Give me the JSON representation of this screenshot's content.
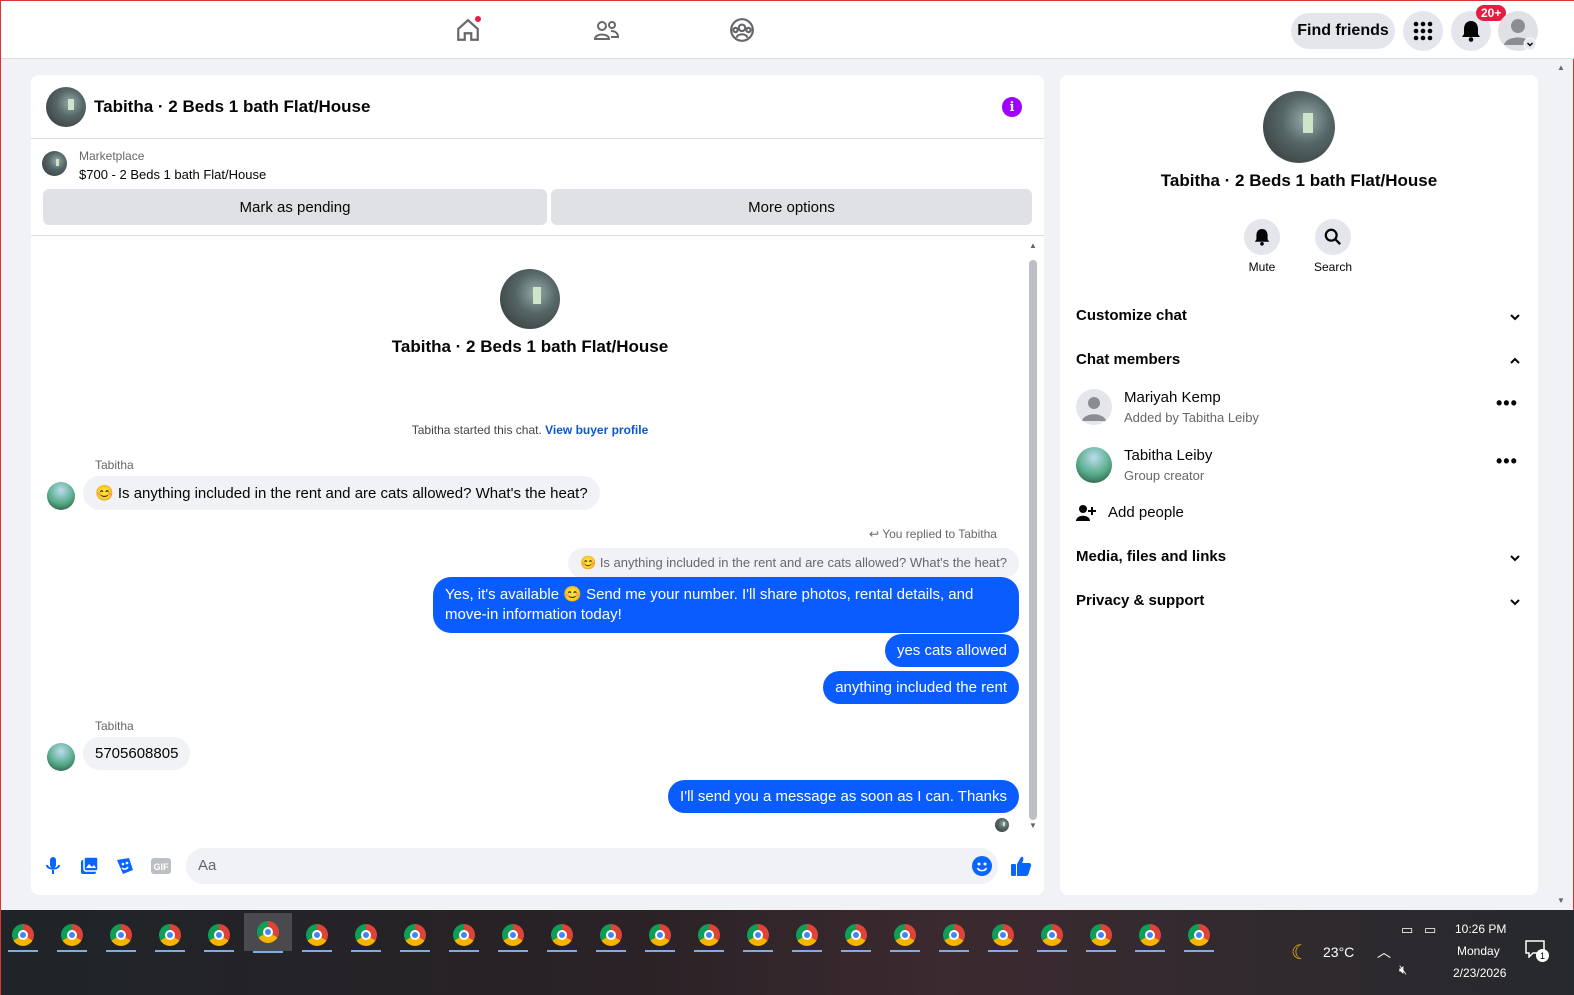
{
  "topbar": {
    "find_friends": "Find friends",
    "notif_badge": "20+"
  },
  "chat": {
    "title": "Tabitha · 2 Beds 1 bath Flat/House",
    "marketplace_label": "Marketplace",
    "listing": "$700 - 2 Beds 1 bath Flat/House",
    "mark_pending": "Mark as pending",
    "more_options": "More options",
    "center_title": "Tabitha · 2 Beds 1 bath Flat/House",
    "started_text": "Tabitha started this chat. ",
    "view_buyer": "View buyer profile",
    "sender1": "Tabitha",
    "msg_in_1": "Is anything included in the rent and are cats allowed? What's the heat?",
    "reply_label": "You replied to Tabitha",
    "quoted": "Is anything included in the rent and are cats allowed? What's the heat?",
    "msg_out_1a": "Yes, it's available ",
    "msg_out_1b": " Send me your number. I'll share photos, rental details, and",
    "msg_out_1c": "move-in information today!",
    "msg_out_2": "yes  cats allowed",
    "msg_out_3": "anything included  the rent",
    "sender2": "Tabitha",
    "msg_in_2": "5705608805",
    "msg_out_4": "I'll send you a message as soon as I can. Thanks",
    "composer_placeholder": "Aa"
  },
  "side": {
    "title": "Tabitha · 2 Beds 1 bath Flat/House",
    "mute": "Mute",
    "search": "Search",
    "customize": "Customize chat",
    "members": "Chat members",
    "member1_name": "Mariyah Kemp",
    "member1_sub": "Added by Tabitha Leiby",
    "member2_name": "Tabitha Leiby",
    "member2_sub": "Group creator",
    "add_people": "Add people",
    "media": "Media, files and links",
    "privacy": "Privacy & support"
  },
  "taskbar": {
    "temp": "23°C",
    "time": "10:26 PM",
    "day": "Monday",
    "date": "2/23/2026",
    "notif_count": "1"
  }
}
